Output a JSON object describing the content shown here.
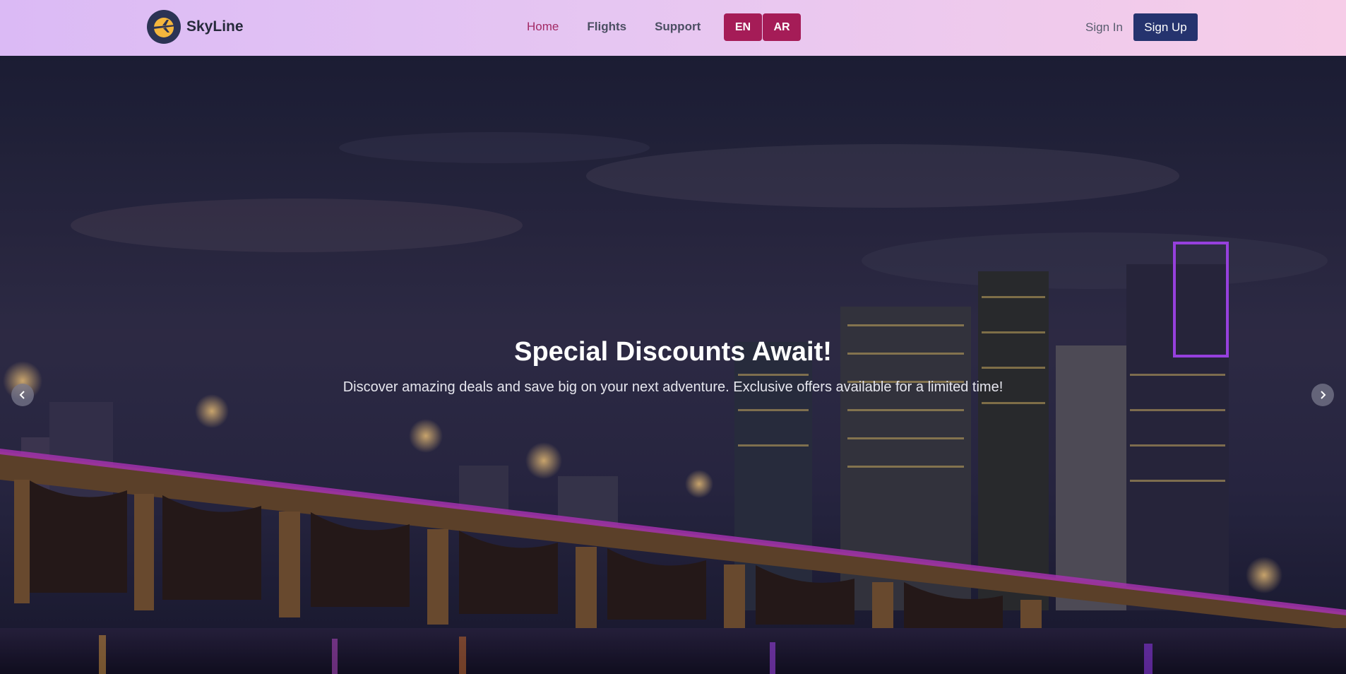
{
  "brand": {
    "name": "SkyLine"
  },
  "nav": {
    "items": [
      "Home",
      "Flights",
      "Support"
    ],
    "active": "Home"
  },
  "language": {
    "options": [
      "EN",
      "AR"
    ]
  },
  "auth": {
    "sign_in": "Sign In",
    "sign_up": "Sign Up"
  },
  "hero": {
    "title": "Special Discounts Await!",
    "subtitle": "Discover amazing deals and save big on your next adventure. Exclusive offers available for a limited time!"
  },
  "icons": {
    "logo": "plane-logo-icon",
    "prev": "chevron-left-icon",
    "next": "chevron-right-icon"
  },
  "colors": {
    "brand_accent": "#a51c57",
    "primary_button": "#25336e",
    "active_nav": "#a32a66"
  }
}
